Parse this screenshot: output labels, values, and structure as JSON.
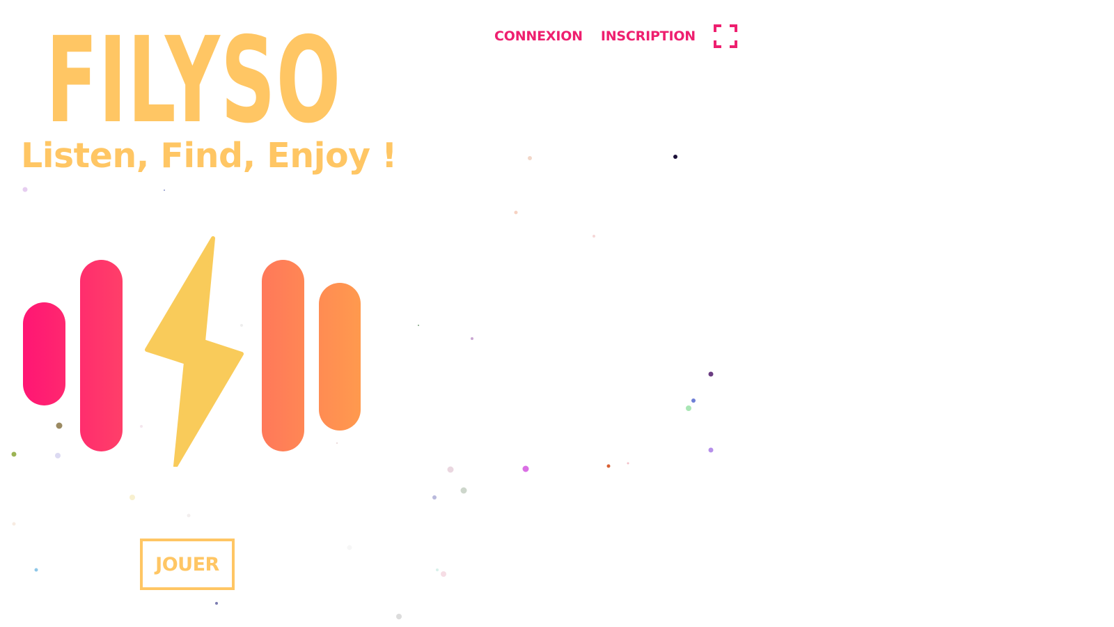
{
  "brand": {
    "logo_text": "FILYSO",
    "tagline": "Listen, Find, Enjoy !"
  },
  "nav": {
    "login_label": "CONNEXION",
    "signup_label": "INSCRIPTION",
    "fullscreen_icon": "fullscreen-icon"
  },
  "emblem": {
    "icon": "sound-bars-lightning-logo-icon",
    "colors": {
      "gradient_start": "#ff1574",
      "gradient_mid": "#ff7a59",
      "gradient_end": "#ff9a4e",
      "bolt": "#f9cb5a"
    }
  },
  "cta": {
    "play_label": "JOUER"
  },
  "colors": {
    "brand_yellow": "#ffc664",
    "accent_pink": "#ee1f6f",
    "background": "#ffffff"
  }
}
